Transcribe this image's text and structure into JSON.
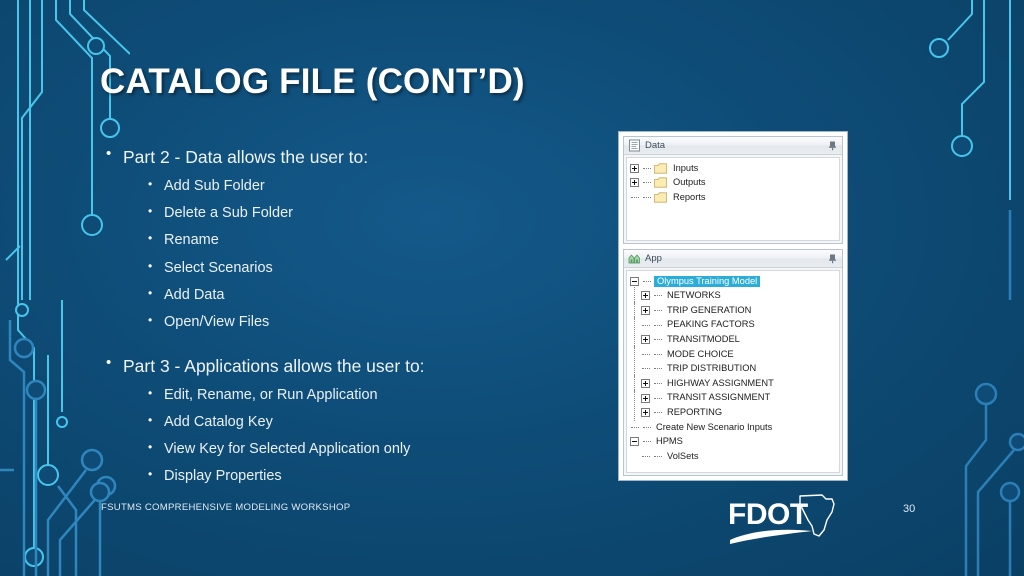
{
  "slide": {
    "title": "CATALOG FILE (CONT’D)",
    "background_color": "#0d4f7c",
    "accent_color": "#4fc3e8",
    "page_number": "30",
    "footer": "FSUTMS COMPREHENSIVE MODELING WORKSHOP",
    "logo_text": "FDOT"
  },
  "body": {
    "sections": [
      {
        "heading": "Part 2 - Data allows the user to:",
        "items": [
          "Add Sub Folder",
          "Delete a Sub Folder",
          "Rename",
          "Select Scenarios",
          "Add Data",
          "Open/View Files"
        ]
      },
      {
        "heading": "Part 3 - Applications allows the user to:",
        "items": [
          "Edit, Rename, or Run Application",
          "Add Catalog Key",
          "View Key for Selected Application only",
          "Display Properties"
        ]
      }
    ]
  },
  "screenshot": {
    "data_panel": {
      "title": "Data",
      "icon": "document-icon",
      "pin_icon": "pushpin-icon",
      "nodes": [
        {
          "label": "Inputs",
          "expander": "plus",
          "icon": "folder-icon",
          "indent": 0,
          "selected": false
        },
        {
          "label": "Outputs",
          "expander": "plus",
          "icon": "folder-icon",
          "indent": 0,
          "selected": false
        },
        {
          "label": "Reports",
          "expander": "none",
          "icon": "folder-icon",
          "indent": 0,
          "selected": false
        }
      ]
    },
    "app_panel": {
      "title": "App",
      "icon": "app-icon",
      "pin_icon": "pushpin-icon",
      "nodes": [
        {
          "label": "Olympus Training Model",
          "expander": "minus",
          "icon": "none",
          "indent": 0,
          "selected": true
        },
        {
          "label": "NETWORKS",
          "expander": "plus",
          "icon": "none",
          "indent": 1,
          "selected": false
        },
        {
          "label": "TRIP GENERATION",
          "expander": "plus",
          "icon": "none",
          "indent": 1,
          "selected": false
        },
        {
          "label": "PEAKING FACTORS",
          "expander": "none",
          "icon": "none",
          "indent": 1,
          "selected": false
        },
        {
          "label": "TRANSITMODEL",
          "expander": "plus",
          "icon": "none",
          "indent": 1,
          "selected": false
        },
        {
          "label": "MODE CHOICE",
          "expander": "none",
          "icon": "none",
          "indent": 1,
          "selected": false
        },
        {
          "label": "TRIP DISTRIBUTION",
          "expander": "none",
          "icon": "none",
          "indent": 1,
          "selected": false
        },
        {
          "label": "HIGHWAY ASSIGNMENT",
          "expander": "plus",
          "icon": "none",
          "indent": 1,
          "selected": false
        },
        {
          "label": "TRANSIT ASSIGNMENT",
          "expander": "plus",
          "icon": "none",
          "indent": 1,
          "selected": false
        },
        {
          "label": "REPORTING",
          "expander": "plus",
          "icon": "none",
          "indent": 1,
          "selected": false
        },
        {
          "label": "Create New Scenario Inputs",
          "expander": "none",
          "icon": "none",
          "indent": 0,
          "selected": false
        },
        {
          "label": "HPMS",
          "expander": "minus",
          "icon": "none",
          "indent": 0,
          "selected": false
        },
        {
          "label": "VolSets",
          "expander": "none",
          "icon": "none",
          "indent": 1,
          "selected": false
        }
      ]
    }
  }
}
